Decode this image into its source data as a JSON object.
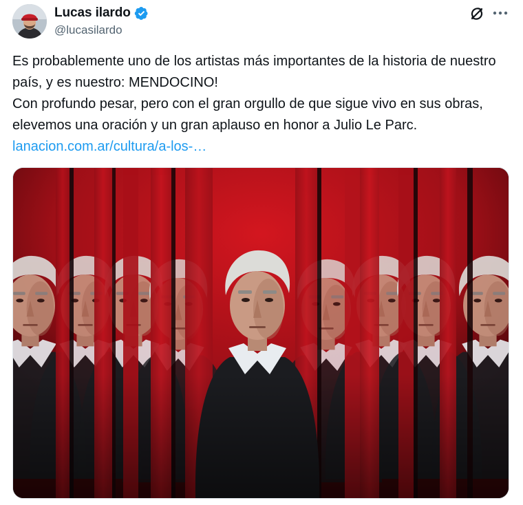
{
  "author": {
    "display_name": "Lucas ilardo",
    "handle": "@lucasilardo",
    "verified": true,
    "verified_color": "#1d9bf0"
  },
  "header_icons": {
    "grok": "grok-icon",
    "more": "more-icon"
  },
  "tweet": {
    "line1": "Es probablemente uno de los artistas más importantes de la historia de nuestro país, y es nuestro: MENDOCINO!",
    "line2": "Con profundo pesar, pero con el gran orgullo de que sigue vivo en sus obras, elevemos una oración y un gran aplauso en honor a Julio Le Parc.",
    "link": "lanacion.com.ar/cultura/a-los-…",
    "link_color": "#1d9bf0"
  },
  "media": {
    "type": "photo",
    "dominant_colors": [
      "#c0151f",
      "#1a1a1a",
      "#e8e2dc"
    ]
  }
}
